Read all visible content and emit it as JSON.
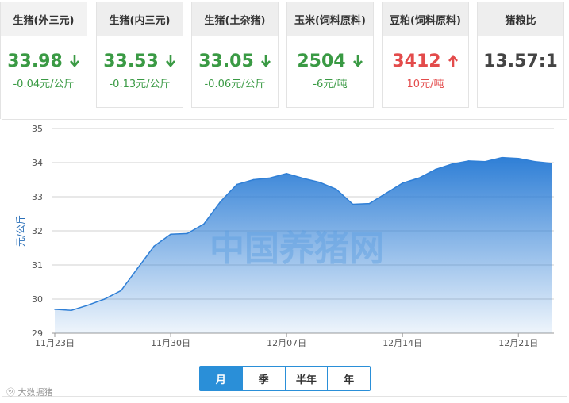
{
  "cards": [
    {
      "title": "生猪(外三元)",
      "value": "33.98",
      "change": "-0.04元/公斤",
      "dir": "down"
    },
    {
      "title": "生猪(内三元)",
      "value": "33.53",
      "change": "-0.13元/公斤",
      "dir": "down"
    },
    {
      "title": "生猪(土杂猪)",
      "value": "33.05",
      "change": "-0.06元/公斤",
      "dir": "down"
    },
    {
      "title": "玉米(饲料原料)",
      "value": "2504",
      "change": "-6元/吨",
      "dir": "down"
    },
    {
      "title": "豆粕(饲料原料)",
      "value": "3412",
      "change": "10元/吨",
      "dir": "up"
    },
    {
      "title": "猪粮比",
      "value": "13.57:1",
      "change": "",
      "dir": "none"
    }
  ],
  "colors": {
    "down": "#3a9a44",
    "up": "#e34b4b",
    "accent": "#2a8fd8",
    "area_top": "#2f7fd6"
  },
  "tabs": {
    "month": "月",
    "quarter": "季",
    "half_year": "半年",
    "year": "年",
    "active": "month"
  },
  "brand": "大数据猪",
  "chart_data": {
    "type": "area",
    "ylabel": "元/公斤",
    "xlabel": "",
    "ylim": [
      29,
      35
    ],
    "yticks": [
      29,
      30,
      31,
      32,
      33,
      34,
      35
    ],
    "xtick_labels": [
      "11月23日",
      "11月30日",
      "12月07日",
      "12月14日",
      "12月21日"
    ],
    "xtick_index": [
      0,
      7,
      14,
      21,
      28
    ],
    "watermark": "中国养猪网",
    "grid": true,
    "values": [
      29.7,
      29.67,
      29.82,
      30.0,
      30.25,
      30.9,
      31.55,
      31.9,
      31.92,
      32.2,
      32.85,
      33.36,
      33.5,
      33.55,
      33.68,
      33.54,
      33.42,
      33.22,
      32.78,
      32.8,
      33.1,
      33.4,
      33.55,
      33.8,
      33.96,
      34.05,
      34.03,
      34.15,
      34.12,
      34.03,
      33.98
    ]
  }
}
